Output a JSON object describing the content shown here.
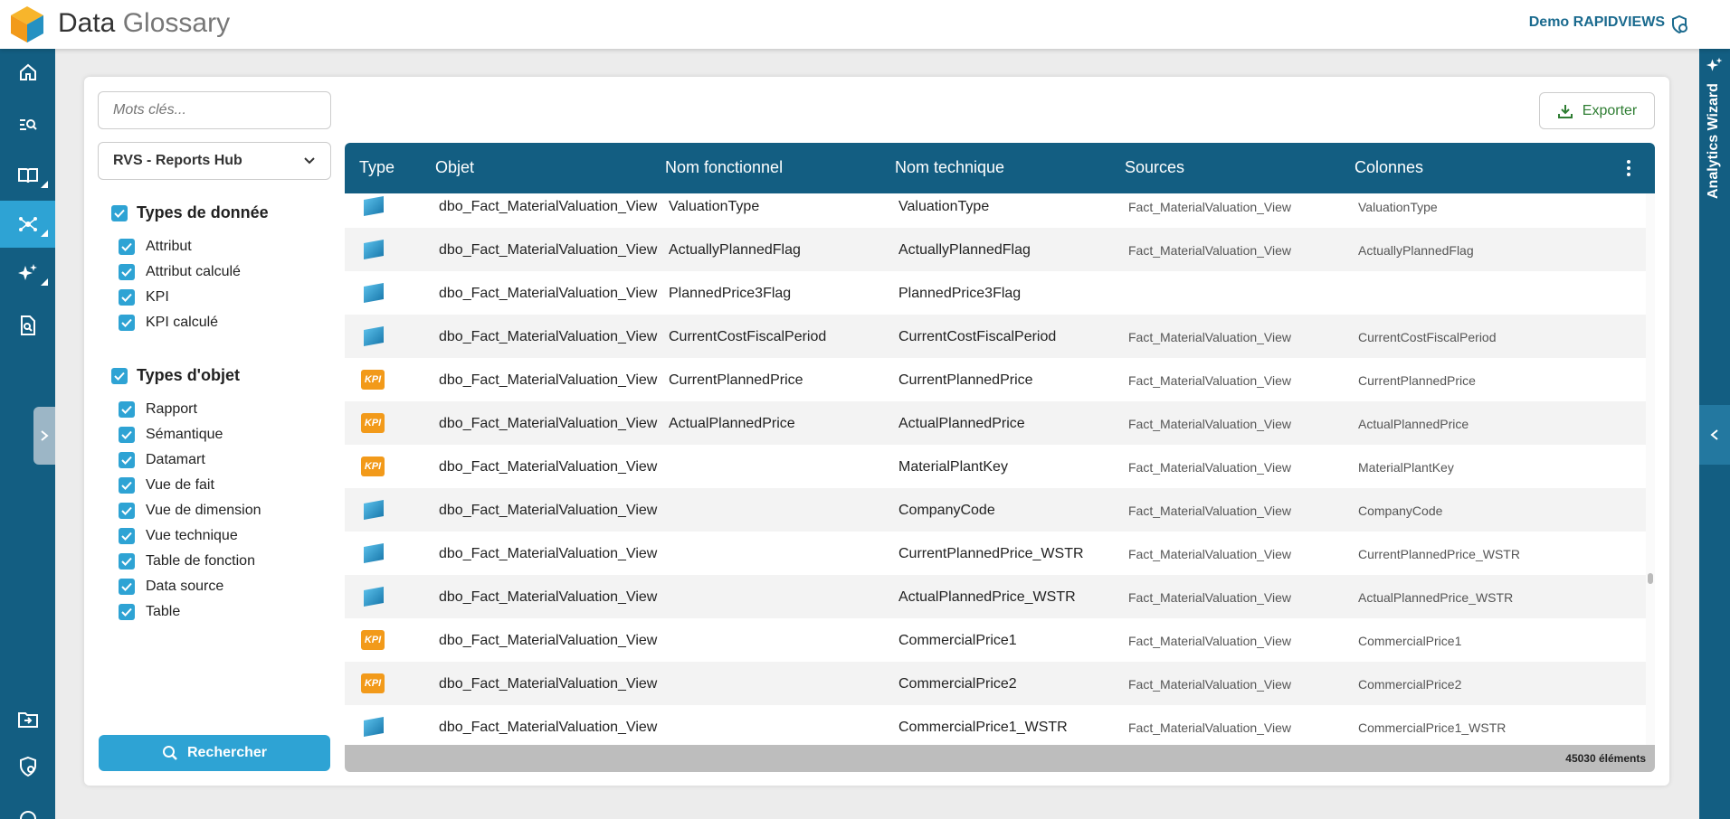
{
  "app": {
    "title_a": "Data",
    "title_b": "Glossary",
    "user": "Demo RAPIDVIEWS"
  },
  "colors": {
    "primary": "#135e82",
    "accent": "#2ea3d4",
    "kpi": "#f29a1a",
    "export": "#2e7d32"
  },
  "left_nav": {
    "items": [
      {
        "icon": "home-icon"
      },
      {
        "icon": "search-list-icon"
      },
      {
        "icon": "book-icon"
      },
      {
        "icon": "network-icon",
        "active": true
      },
      {
        "icon": "sparkles-icon"
      },
      {
        "icon": "document-search-icon"
      }
    ],
    "bottom_items": [
      {
        "icon": "folder-export-icon"
      },
      {
        "icon": "security-settings-icon"
      },
      {
        "icon": "support-icon"
      }
    ]
  },
  "right_panel": {
    "label": "Analytics Wizard"
  },
  "filters": {
    "keywords_placeholder": "Mots clés...",
    "source_selected": "RVS - Reports Hub",
    "data_types": {
      "title": "Types de donnée",
      "items": [
        "Attribut",
        "Attribut calculé",
        "KPI",
        "KPI calculé"
      ]
    },
    "object_types": {
      "title": "Types d'objet",
      "items": [
        "Rapport",
        "Sémantique",
        "Datamart",
        "Vue de fait",
        "Vue de dimension",
        "Vue technique",
        "Table de fonction",
        "Data source",
        "Table"
      ]
    },
    "search_label": "Rechercher"
  },
  "export_label": "Exporter",
  "grid": {
    "headers": [
      "Type",
      "Objet",
      "Nom fonctionnel",
      "Nom technique",
      "Sources",
      "Colonnes"
    ],
    "rows": [
      {
        "type": "attribute",
        "objet": "dbo_Fact_MaterialValuation_View",
        "nom_fonctionnel": "ValuationType",
        "nom_technique": "ValuationType",
        "sources": "Fact_MaterialValuation_View",
        "colonnes": "ValuationType"
      },
      {
        "type": "attribute",
        "objet": "dbo_Fact_MaterialValuation_View",
        "nom_fonctionnel": "ActuallyPlannedFlag",
        "nom_technique": "ActuallyPlannedFlag",
        "sources": "Fact_MaterialValuation_View",
        "colonnes": "ActuallyPlannedFlag"
      },
      {
        "type": "attribute",
        "objet": "dbo_Fact_MaterialValuation_View",
        "nom_fonctionnel": "PlannedPrice3Flag",
        "nom_technique": "PlannedPrice3Flag",
        "sources": "",
        "colonnes": ""
      },
      {
        "type": "attribute",
        "objet": "dbo_Fact_MaterialValuation_View",
        "nom_fonctionnel": "CurrentCostFiscalPeriod",
        "nom_technique": "CurrentCostFiscalPeriod",
        "sources": "Fact_MaterialValuation_View",
        "colonnes": "CurrentCostFiscalPeriod"
      },
      {
        "type": "kpi",
        "objet": "dbo_Fact_MaterialValuation_View",
        "nom_fonctionnel": "CurrentPlannedPrice",
        "nom_technique": "CurrentPlannedPrice",
        "sources": "Fact_MaterialValuation_View",
        "colonnes": "CurrentPlannedPrice"
      },
      {
        "type": "kpi",
        "objet": "dbo_Fact_MaterialValuation_View",
        "nom_fonctionnel": "ActualPlannedPrice",
        "nom_technique": "ActualPlannedPrice",
        "sources": "Fact_MaterialValuation_View",
        "colonnes": "ActualPlannedPrice"
      },
      {
        "type": "kpi",
        "objet": "dbo_Fact_MaterialValuation_View",
        "nom_fonctionnel": "",
        "nom_technique": "MaterialPlantKey",
        "sources": "Fact_MaterialValuation_View",
        "colonnes": "MaterialPlantKey"
      },
      {
        "type": "attribute",
        "objet": "dbo_Fact_MaterialValuation_View",
        "nom_fonctionnel": "",
        "nom_technique": "CompanyCode",
        "sources": "Fact_MaterialValuation_View",
        "colonnes": "CompanyCode"
      },
      {
        "type": "attribute",
        "objet": "dbo_Fact_MaterialValuation_View",
        "nom_fonctionnel": "",
        "nom_technique": "CurrentPlannedPrice_WSTR",
        "sources": "Fact_MaterialValuation_View",
        "colonnes": "CurrentPlannedPrice_WSTR"
      },
      {
        "type": "attribute",
        "objet": "dbo_Fact_MaterialValuation_View",
        "nom_fonctionnel": "",
        "nom_technique": "ActualPlannedPrice_WSTR",
        "sources": "Fact_MaterialValuation_View",
        "colonnes": "ActualPlannedPrice_WSTR"
      },
      {
        "type": "kpi",
        "objet": "dbo_Fact_MaterialValuation_View",
        "nom_fonctionnel": "",
        "nom_technique": "CommercialPrice1",
        "sources": "Fact_MaterialValuation_View",
        "colonnes": "CommercialPrice1"
      },
      {
        "type": "kpi",
        "objet": "dbo_Fact_MaterialValuation_View",
        "nom_fonctionnel": "",
        "nom_technique": "CommercialPrice2",
        "sources": "Fact_MaterialValuation_View",
        "colonnes": "CommercialPrice2"
      },
      {
        "type": "attribute",
        "objet": "dbo_Fact_MaterialValuation_View",
        "nom_fonctionnel": "",
        "nom_technique": "CommercialPrice1_WSTR",
        "sources": "Fact_MaterialValuation_View",
        "colonnes": "CommercialPrice1_WSTR"
      }
    ],
    "kpi_badge": "KPI",
    "count": "45030 éléments"
  }
}
